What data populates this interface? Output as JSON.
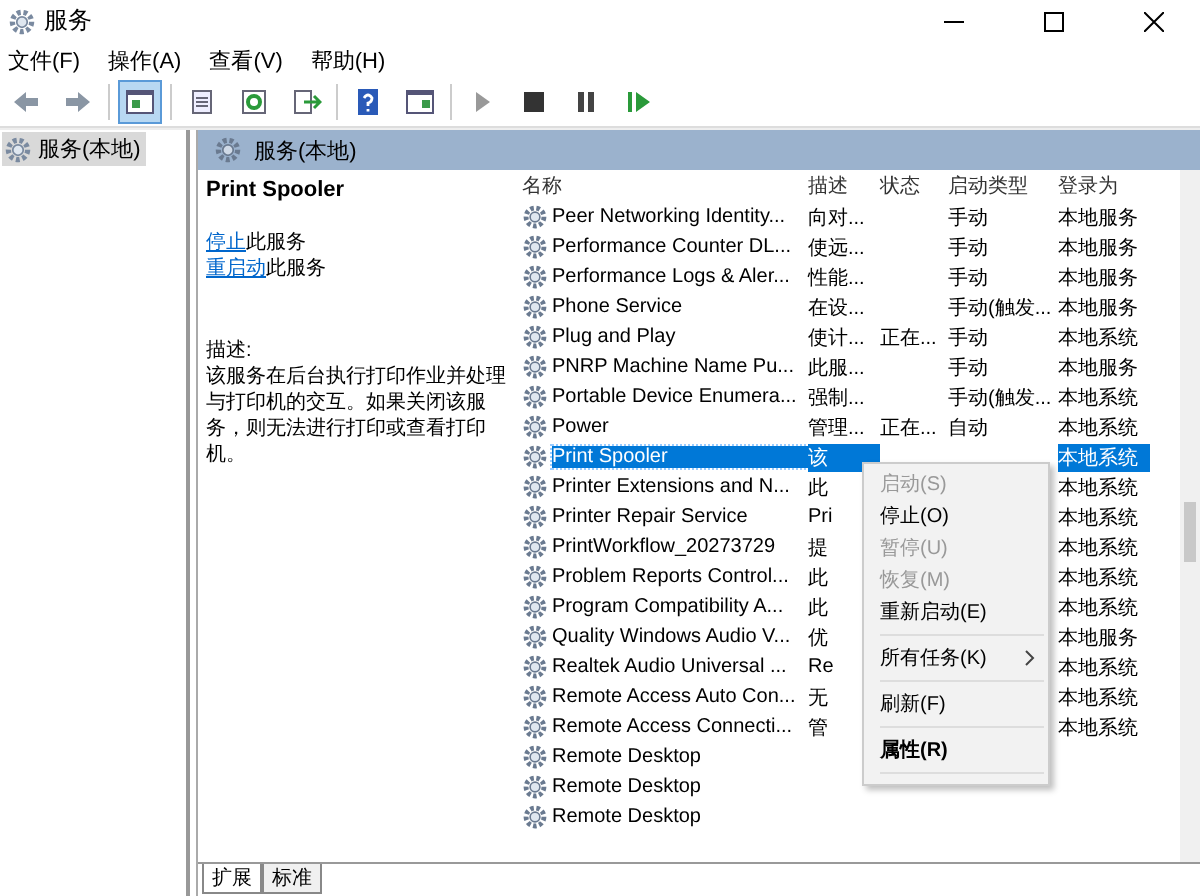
{
  "window": {
    "title": "服务"
  },
  "menu": [
    "文件(F)",
    "操作(A)",
    "查看(V)",
    "帮助(H)"
  ],
  "toolbar": [
    {
      "kind": "back",
      "selected": false
    },
    {
      "kind": "forward",
      "selected": false
    },
    {
      "kind": "sep"
    },
    {
      "kind": "tree",
      "selected": true
    },
    {
      "kind": "sep"
    },
    {
      "kind": "props",
      "selected": false
    },
    {
      "kind": "refresh",
      "selected": false
    },
    {
      "kind": "export",
      "selected": false
    },
    {
      "kind": "sep"
    },
    {
      "kind": "help",
      "selected": false
    },
    {
      "kind": "console",
      "selected": false
    },
    {
      "kind": "sep"
    },
    {
      "kind": "play",
      "selected": false
    },
    {
      "kind": "stop",
      "selected": false
    },
    {
      "kind": "pause",
      "selected": false
    },
    {
      "kind": "restart",
      "selected": false
    }
  ],
  "tree": {
    "items": [
      {
        "label": "服务(本地)",
        "selected": true
      }
    ]
  },
  "panel": {
    "title": "服务(本地)"
  },
  "details": {
    "service_name": "Print Spooler",
    "actions": [
      {
        "link": "停止",
        "text": "此服务"
      },
      {
        "link": "重启动",
        "text": "此服务"
      }
    ],
    "description_label": "描述:",
    "description": "该服务在后台执行打印作业并处理与打印机的交互。如果关闭该服务，则无法进行打印或查看打印机。"
  },
  "table": {
    "columns": [
      "名称",
      "描述",
      "状态",
      "启动类型",
      "登录为"
    ],
    "rows": [
      {
        "name": "Peer Networking Identity...",
        "desc": "向对...",
        "status": "",
        "startup": "手动",
        "logon": "本地服务",
        "selected": false
      },
      {
        "name": "Performance Counter DL...",
        "desc": "使远...",
        "status": "",
        "startup": "手动",
        "logon": "本地服务",
        "selected": false
      },
      {
        "name": "Performance Logs & Aler...",
        "desc": "性能...",
        "status": "",
        "startup": "手动",
        "logon": "本地服务",
        "selected": false
      },
      {
        "name": "Phone Service",
        "desc": "在设...",
        "status": "",
        "startup": "手动(触发...",
        "logon": "本地服务",
        "selected": false
      },
      {
        "name": "Plug and Play",
        "desc": "使计...",
        "status": "正在...",
        "startup": "手动",
        "logon": "本地系统",
        "selected": false
      },
      {
        "name": "PNRP Machine Name Pu...",
        "desc": "此服...",
        "status": "",
        "startup": "手动",
        "logon": "本地服务",
        "selected": false
      },
      {
        "name": "Portable Device Enumera...",
        "desc": "强制...",
        "status": "",
        "startup": "手动(触发...",
        "logon": "本地系统",
        "selected": false
      },
      {
        "name": "Power",
        "desc": "管理...",
        "status": "正在...",
        "startup": "自动",
        "logon": "本地系统",
        "selected": false
      },
      {
        "name": "Print Spooler",
        "desc": "该",
        "status": "",
        "startup": "",
        "logon": "本地系统",
        "selected": true
      },
      {
        "name": "Printer Extensions and N...",
        "desc": "此",
        "status": "",
        "startup": "",
        "logon": "本地系统",
        "selected": false
      },
      {
        "name": "Printer Repair Service",
        "desc": "Pri",
        "status": "",
        "startup": "",
        "logon": "本地系统",
        "selected": false
      },
      {
        "name": "PrintWorkflow_20273729",
        "desc": "提",
        "status": "",
        "startup": "",
        "logon": "本地系统",
        "selected": false
      },
      {
        "name": "Problem Reports Control...",
        "desc": "此",
        "status": "",
        "startup": "",
        "logon": "本地系统",
        "selected": false
      },
      {
        "name": "Program Compatibility A...",
        "desc": "此",
        "status": "",
        "startup": "",
        "logon": "本地系统",
        "selected": false
      },
      {
        "name": "Quality Windows Audio V...",
        "desc": "优",
        "status": "",
        "startup": "",
        "logon": "本地服务",
        "selected": false
      },
      {
        "name": "Realtek Audio Universal ...",
        "desc": "Re",
        "status": "",
        "startup": "",
        "logon": "本地系统",
        "selected": false
      },
      {
        "name": "Remote Access Auto Con...",
        "desc": "无",
        "status": "",
        "startup": "",
        "logon": "本地系统",
        "selected": false
      },
      {
        "name": "Remote Access Connecti...",
        "desc": "管",
        "status": "",
        "startup": "",
        "logon": "本地系统",
        "selected": false
      },
      {
        "name": "Remote Desktop",
        "desc": "",
        "status": "",
        "startup": "",
        "logon": "",
        "selected": false
      },
      {
        "name": "Remote Desktop",
        "desc": "",
        "status": "",
        "startup": "",
        "logon": "",
        "selected": false
      },
      {
        "name": "Remote Desktop",
        "desc": "",
        "status": "",
        "startup": "",
        "logon": "",
        "selected": false
      }
    ]
  },
  "context_menu": {
    "items": [
      {
        "kind": "item",
        "label": "启动(S)",
        "disabled": true,
        "bold": false,
        "submenu": false
      },
      {
        "kind": "item",
        "label": "停止(O)",
        "disabled": false,
        "bold": false,
        "submenu": false
      },
      {
        "kind": "item",
        "label": "暂停(U)",
        "disabled": true,
        "bold": false,
        "submenu": false
      },
      {
        "kind": "item",
        "label": "恢复(M)",
        "disabled": true,
        "bold": false,
        "submenu": false
      },
      {
        "kind": "item",
        "label": "重新启动(E)",
        "disabled": false,
        "bold": false,
        "submenu": false
      },
      {
        "kind": "separator"
      },
      {
        "kind": "item",
        "label": "所有任务(K)",
        "disabled": false,
        "bold": false,
        "submenu": true
      },
      {
        "kind": "separator"
      },
      {
        "kind": "item",
        "label": "刷新(F)",
        "disabled": false,
        "bold": false,
        "submenu": false
      },
      {
        "kind": "separator"
      },
      {
        "kind": "item",
        "label": "属性(R)",
        "disabled": false,
        "bold": true,
        "submenu": false
      },
      {
        "kind": "separator"
      }
    ]
  },
  "bottom_tabs": [
    {
      "label": "扩展",
      "selected": true
    },
    {
      "label": "标准",
      "selected": false
    }
  ]
}
